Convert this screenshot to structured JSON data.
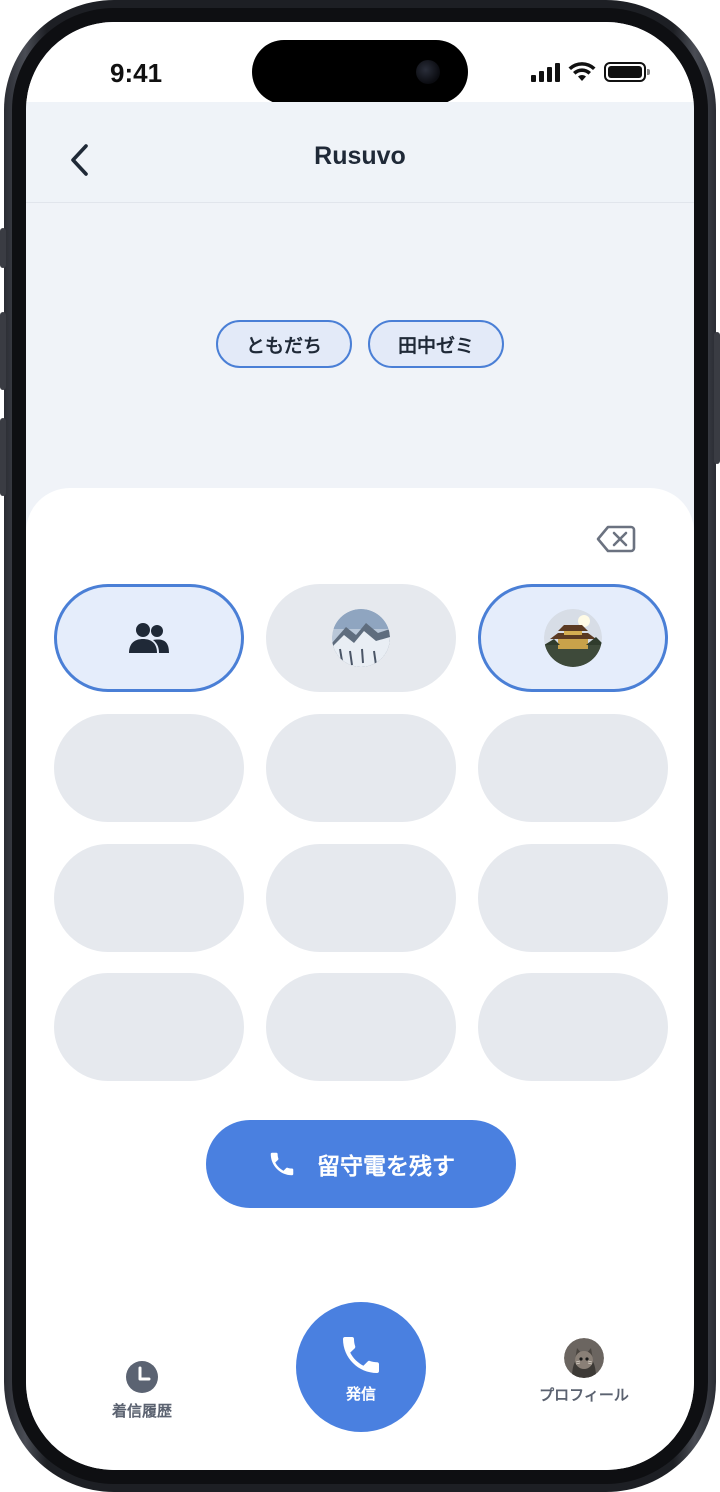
{
  "status_bar": {
    "time": "9:41"
  },
  "header": {
    "title": "Rusuvo"
  },
  "tags": [
    "ともだち",
    "田中ゼミ"
  ],
  "keypad": {
    "keys": [
      {
        "kind": "group-icon",
        "selected": true
      },
      {
        "kind": "photo-mountain",
        "selected": false
      },
      {
        "kind": "photo-temple",
        "selected": true
      },
      {
        "kind": "empty"
      },
      {
        "kind": "empty"
      },
      {
        "kind": "empty"
      },
      {
        "kind": "empty"
      },
      {
        "kind": "empty"
      },
      {
        "kind": "empty"
      },
      {
        "kind": "empty"
      },
      {
        "kind": "empty"
      },
      {
        "kind": "empty"
      }
    ]
  },
  "voicemail_button": {
    "label": "留守電を残す"
  },
  "tabbar": {
    "history_label": "着信履歴",
    "call_label": "発信",
    "profile_label": "プロフィール"
  },
  "colors": {
    "accent": "#4a80e0",
    "selected_border": "#4a7fd6",
    "key_bg": "#e6e9ee"
  }
}
